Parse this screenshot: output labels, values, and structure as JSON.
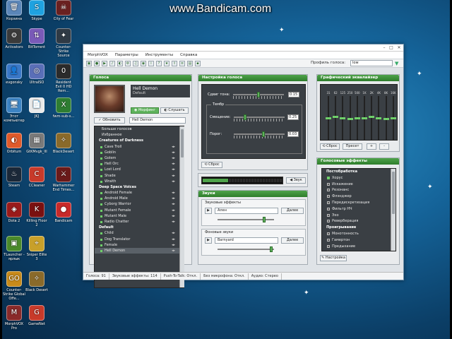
{
  "watermark": "www.Bandicam.com",
  "desktop_icons": [
    {
      "label": "Корзина",
      "color": "#5b86b8",
      "glyph": "🗑"
    },
    {
      "label": "Skype",
      "color": "#1fa2e0",
      "glyph": "S"
    },
    {
      "label": "City of Fear",
      "color": "#6a2020",
      "glyph": "☠"
    },
    {
      "label": "Activators",
      "color": "#3a3a3a",
      "glyph": "⚙"
    },
    {
      "label": "BitTorrent",
      "color": "#7a5ab8",
      "glyph": "⇅"
    },
    {
      "label": "Counter-Strike Source",
      "color": "#2f3a45",
      "glyph": "✦"
    },
    {
      "label": "evgonsky",
      "color": "#3a78c8",
      "glyph": "👤"
    },
    {
      "label": "UltraISO",
      "color": "#5a6fb8",
      "glyph": "◎"
    },
    {
      "label": "Resident Evil 0 HD Rem...",
      "color": "#2b2b2b",
      "glyph": "0"
    },
    {
      "label": "Этот компьютер",
      "color": "#3d84c4",
      "glyph": "🖥"
    },
    {
      "label": "JKJ",
      "color": "#eaeaea",
      "glyph": "📄"
    },
    {
      "label": "fwm-sub-s...",
      "color": "#2e7d32",
      "glyph": "X"
    },
    {
      "label": "Orbitum",
      "color": "#e05a2a",
      "glyph": "◐"
    },
    {
      "label": "GtKMvgk_III",
      "color": "#7a7a7a",
      "glyph": "▦"
    },
    {
      "label": "BlackDesert",
      "color": "#8a6a2a",
      "glyph": "✧"
    },
    {
      "label": "Steam",
      "color": "#1b2838",
      "glyph": "♨"
    },
    {
      "label": "CCleaner",
      "color": "#c83a2a",
      "glyph": "C"
    },
    {
      "label": "Warhammer End Times...",
      "color": "#6a1a1a",
      "glyph": "⚔"
    },
    {
      "label": "Dota 2",
      "color": "#9a1a1a",
      "glyph": "◈"
    },
    {
      "label": "Killing Floor 2",
      "color": "#7a1010",
      "glyph": "K"
    },
    {
      "label": "Bandicam",
      "color": "#c82a2a",
      "glyph": "●"
    },
    {
      "label": "TLauncher - ярлык",
      "color": "#4a8a2a",
      "glyph": "▣"
    },
    {
      "label": "Sniper Elite 3",
      "color": "#c8a02a",
      "glyph": "⌖"
    },
    {
      "label": "Counter-Strike Global Offe...",
      "color": "#c88a1a",
      "glyph": "GO"
    },
    {
      "label": "Black Desert",
      "color": "#8a6a2a",
      "glyph": "✧"
    },
    {
      "label": "MorphVOX Pro",
      "color": "#8a2a2a",
      "glyph": "M"
    },
    {
      "label": "GameNet",
      "color": "#c83a2a",
      "glyph": "G"
    }
  ],
  "window": {
    "menu": [
      "MorphVOX",
      "Параметры",
      "Инструменты",
      "Справка"
    ],
    "profile_label": "Профиль голоса:",
    "profile_value": "low"
  },
  "voices_panel": {
    "title": "Голоса",
    "voice_name": "Hell Demon",
    "voice_sub": "Default",
    "morph_label": "Морфинг",
    "listen_label": "Слушать",
    "update_label": "Обновить",
    "voice_select": "Hell Demon",
    "list": [
      {
        "kind": "plain",
        "label": "Больше голосов"
      },
      {
        "kind": "plain",
        "label": "Избранное"
      },
      {
        "kind": "cat",
        "label": "Creatures of Darkness"
      },
      {
        "kind": "item",
        "label": "Cave Troll"
      },
      {
        "kind": "item",
        "label": "Goblin"
      },
      {
        "kind": "item",
        "label": "Golem"
      },
      {
        "kind": "item",
        "label": "Hell Orc"
      },
      {
        "kind": "item",
        "label": "Lost Lord"
      },
      {
        "kind": "item",
        "label": "Shade"
      },
      {
        "kind": "item",
        "label": "Wraith"
      },
      {
        "kind": "cat",
        "label": "Deep Space Voices"
      },
      {
        "kind": "item",
        "label": "Android Female"
      },
      {
        "kind": "item",
        "label": "Android Male"
      },
      {
        "kind": "item",
        "label": "Cyborg Warrior"
      },
      {
        "kind": "item",
        "label": "Mutant Female"
      },
      {
        "kind": "item",
        "label": "Mutant Male"
      },
      {
        "kind": "item",
        "label": "Radio Chatter"
      },
      {
        "kind": "cat",
        "label": "Default"
      },
      {
        "kind": "item",
        "label": "Child"
      },
      {
        "kind": "item",
        "label": "Dog Translator"
      },
      {
        "kind": "item",
        "label": "Female"
      },
      {
        "kind": "item",
        "label": "Hell Demon",
        "selected": true
      }
    ]
  },
  "tune_panel": {
    "title": "Настройка голоса",
    "pitch_label": "Сдвиг тона:",
    "pitch_value": "0.15",
    "timbre_group": "Тембр",
    "timbre_shift_label": "Смещение:",
    "timbre_shift_value": "0.25",
    "threshold_label": "Порог:",
    "threshold_value": "0.03",
    "reset_label": "Сброс"
  },
  "sound_meter": {
    "sound_button": "Звук"
  },
  "sounds_panel": {
    "title": "Звуки",
    "effects_group": "Звуковые эффекты",
    "effect_select": "Ален",
    "effect_add": "Далее",
    "bg_group": "Фоновые звуки",
    "bg_select": "Barnyard",
    "bg_add": "Далее"
  },
  "eq_panel": {
    "title": "Графический эквалайзер",
    "freqs": [
      "31",
      "62",
      "125",
      "250",
      "500",
      "1K",
      "2K",
      "4K",
      "8K",
      "16K"
    ],
    "levels": [
      0.5,
      0.52,
      0.5,
      0.48,
      0.5,
      0.5,
      0.52,
      0.5,
      0.48,
      0.5
    ],
    "reset_label": "Сброс",
    "preset_label": "Пресет",
    "add_label": "+",
    "remove_label": "-"
  },
  "fx_panel": {
    "title": "Голосовые эффекты",
    "list": [
      {
        "kind": "cat",
        "label": "Постобработка"
      },
      {
        "kind": "item",
        "label": "Хорус",
        "on": true
      },
      {
        "kind": "item",
        "label": "Искажение",
        "on": false
      },
      {
        "kind": "item",
        "label": "Резонанс",
        "on": false
      },
      {
        "kind": "item",
        "label": "Флэнджер",
        "on": false
      },
      {
        "kind": "item",
        "label": "Передискретизация",
        "on": false
      },
      {
        "kind": "item",
        "label": "Фильтр НЧ",
        "on": false
      },
      {
        "kind": "item",
        "label": "Эхо",
        "on": false
      },
      {
        "kind": "item",
        "label": "Реверберация",
        "on": false
      },
      {
        "kind": "cat",
        "label": "Проигрывание"
      },
      {
        "kind": "item",
        "label": "Монотонность",
        "on": false
      },
      {
        "kind": "item",
        "label": "Гамертон",
        "on": false
      },
      {
        "kind": "item",
        "label": "Предыхание",
        "on": false
      }
    ],
    "settings_label": "Настройка"
  },
  "status": [
    "Голоса: 91",
    "Звуковые эффекты: 114",
    "Push-To-Talk: Откл.",
    "Без микрофона: Откл.",
    "Аудио: Стерео"
  ]
}
